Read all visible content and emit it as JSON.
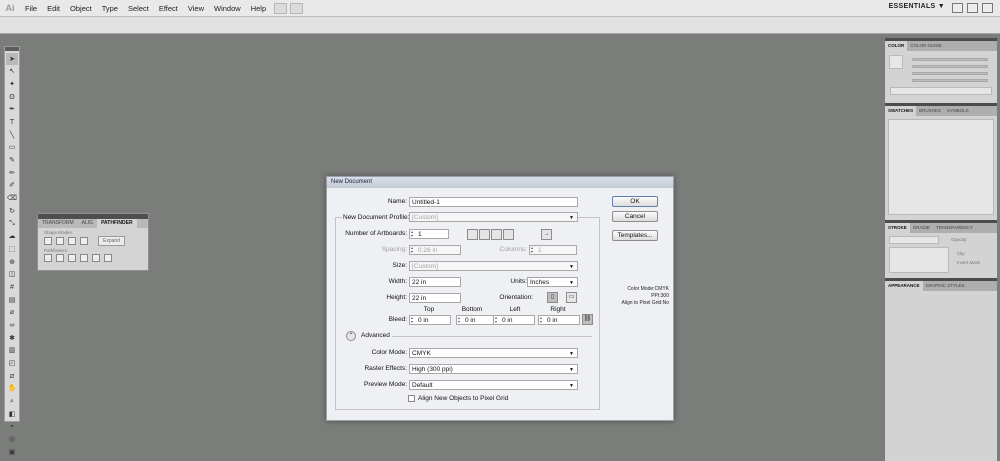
{
  "app": {
    "logo": "Ai"
  },
  "menu": [
    "File",
    "Edit",
    "Object",
    "Type",
    "Select",
    "Effect",
    "View",
    "Window",
    "Help"
  ],
  "workspace": "ESSENTIALS ▼",
  "pathfinder": {
    "tabs": [
      "TRANSFORM",
      "ALIG",
      "PATHFINDER"
    ],
    "shape_modes_label": "Shape Modes:",
    "pathfinders_label": "Pathfinders:",
    "expand_label": "Expand"
  },
  "right_panels": {
    "color_tabs": [
      "COLOR",
      "COLOR GUIDE"
    ],
    "swatch_tabs": [
      "SWATCHES",
      "BRUSHES",
      "SYMBOLS"
    ],
    "stroke_tabs": [
      "STROKE",
      "GRADIE",
      "TRANSPARENCY"
    ],
    "opacity_label": "Opacity:",
    "clip_label": "Clip",
    "invert_mask_label": "Invert Mask",
    "appearance_tabs": [
      "APPEARANCE",
      "GRAPHIC STYLES"
    ]
  },
  "dialog": {
    "title": "New Document",
    "name_label": "Name:",
    "name_value": "Untitled-1",
    "profile_label": "New Document Profile:",
    "profile_value": "[Custom]",
    "artboards_label": "Number of Artboards:",
    "artboards_value": "1",
    "spacing_label": "Spacing:",
    "spacing_value": "0.28 in",
    "columns_label": "Columns:",
    "columns_value": "1",
    "size_label": "Size:",
    "size_value": "[Custom]",
    "width_label": "Width:",
    "width_value": "22 in",
    "units_label": "Units:",
    "units_value": "Inches",
    "height_label": "Height:",
    "height_value": "22 in",
    "orientation_label": "Orientation:",
    "bleed_label": "Bleed:",
    "bleed_top_label": "Top",
    "bleed_bottom_label": "Bottom",
    "bleed_left_label": "Left",
    "bleed_right_label": "Right",
    "bleed_top": "0 in",
    "bleed_bottom": "0 in",
    "bleed_left": "0 in",
    "bleed_right": "0 in",
    "advanced_label": "Advanced",
    "color_mode_label": "Color Mode:",
    "color_mode_value": "CMYK",
    "raster_label": "Raster Effects:",
    "raster_value": "High (300 ppi)",
    "preview_label": "Preview Mode:",
    "preview_value": "Default",
    "align_pixel_label": "Align New Objects to Pixel Grid",
    "ok_label": "OK",
    "cancel_label": "Cancel",
    "templates_label": "Templates...",
    "info_color_mode": "Color Mode:CMYK",
    "info_ppi": "PPI:300",
    "info_align": "Align to Pixel Grid:No"
  }
}
